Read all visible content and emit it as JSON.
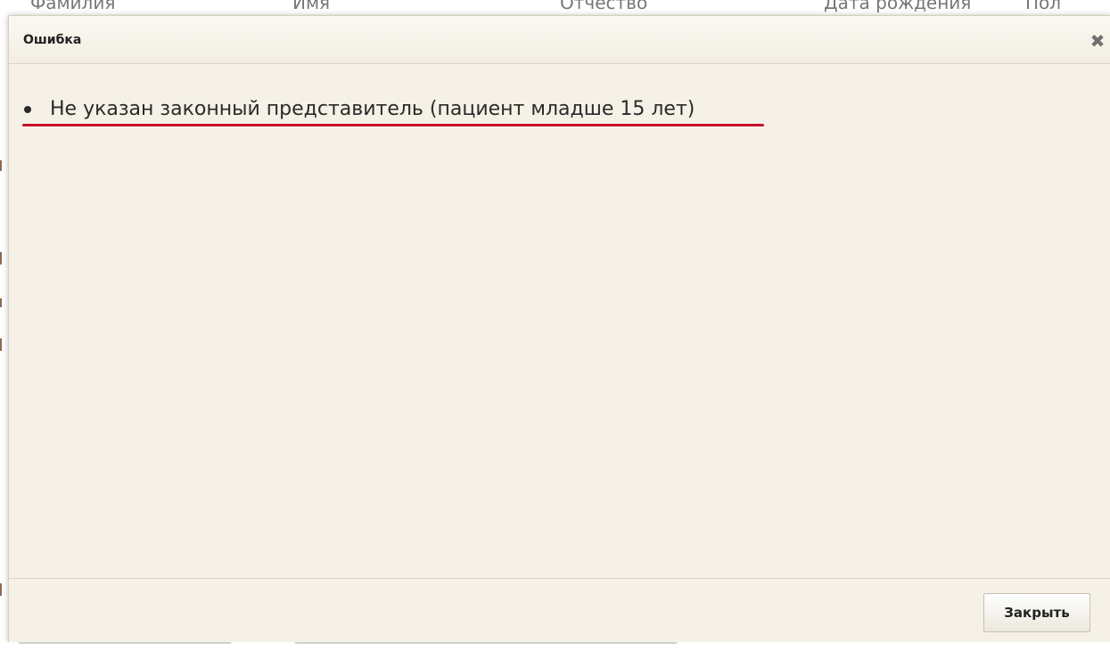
{
  "background_table": {
    "columns": [
      "Фамилия",
      "Имя",
      "Отчество",
      "Дата рождения",
      "Пол"
    ]
  },
  "dialog": {
    "title": "Ошибка",
    "close_icon": "close-x-icon",
    "errors": [
      "Не указан законный представитель (пациент младше 15 лет)"
    ],
    "close_button_label": "Закрыть"
  },
  "colors": {
    "dialog_background": "#f5f1e6",
    "annotation_underline": "#c8102e"
  }
}
